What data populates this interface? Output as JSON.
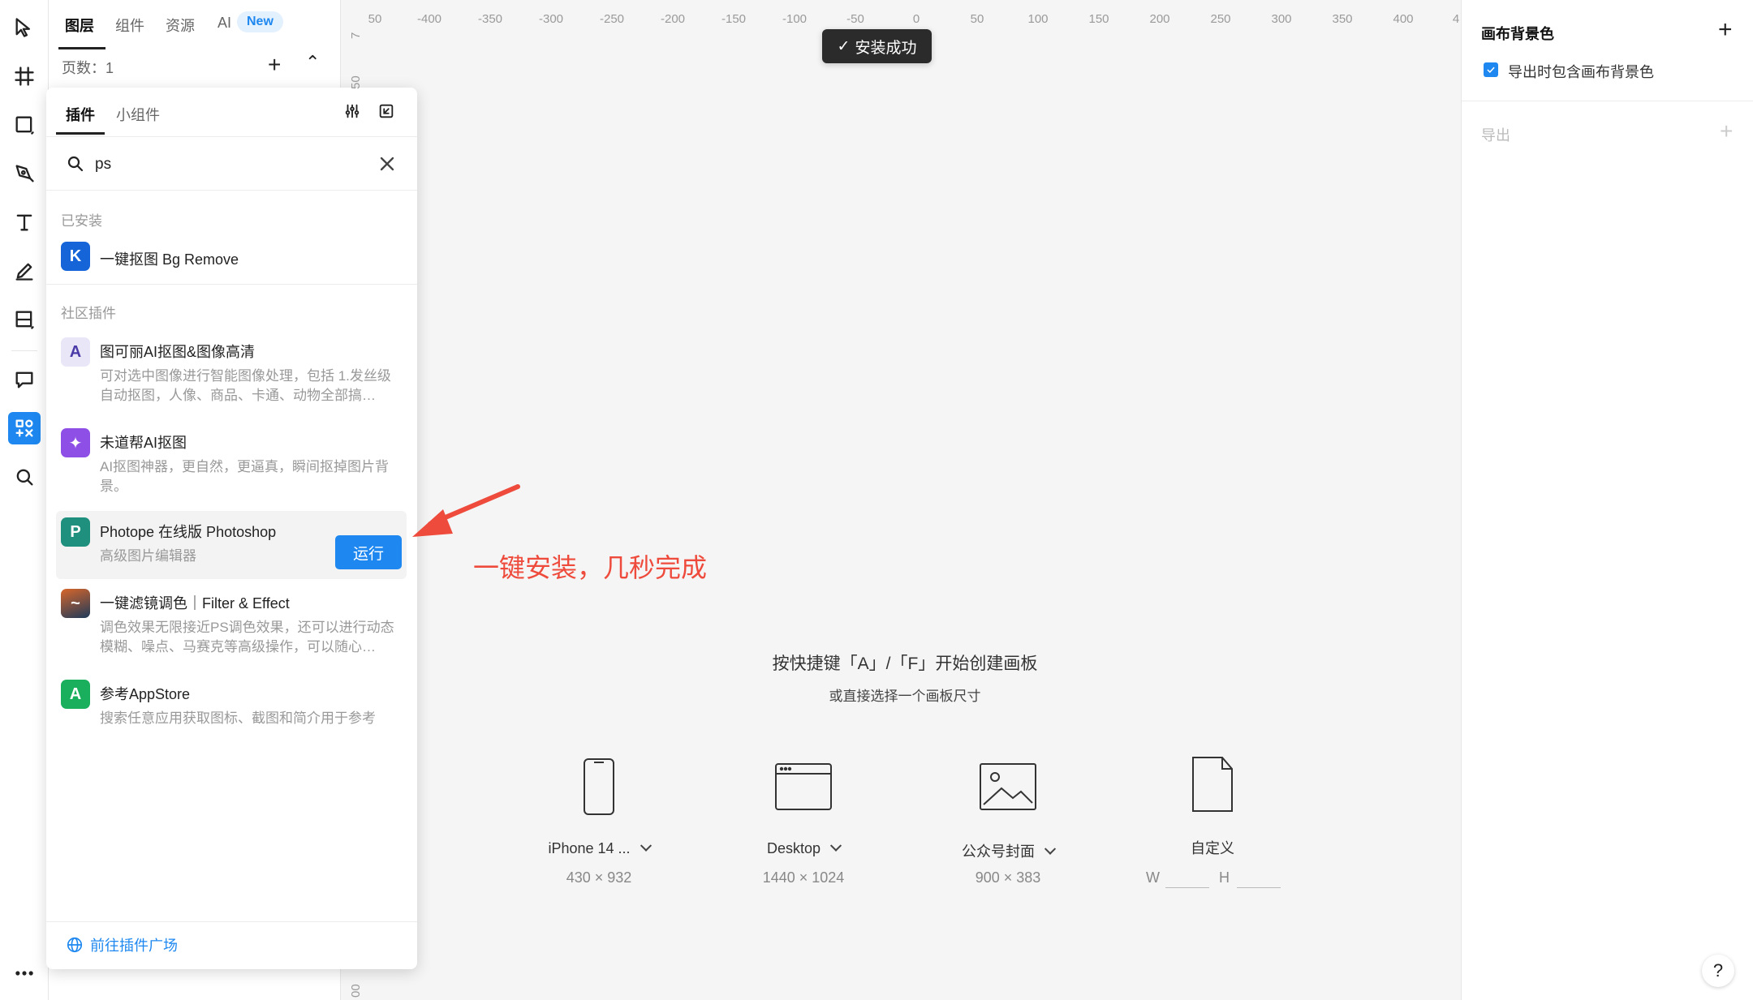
{
  "layer_panel": {
    "tabs": [
      {
        "label": "图层",
        "active": true
      },
      {
        "label": "组件",
        "active": false
      },
      {
        "label": "资源",
        "active": false
      },
      {
        "label": "AI",
        "active": false
      }
    ],
    "new_badge": "New",
    "pages_label": "页数：1"
  },
  "plugin_panel": {
    "tabs": [
      {
        "label": "插件",
        "active": true
      },
      {
        "label": "小组件",
        "active": false
      }
    ],
    "search": {
      "value": "ps",
      "placeholder": ""
    },
    "installed_label": "已安装",
    "installed": [
      {
        "title": "一键抠图 Bg Remove",
        "icon_color": "#1565d8"
      }
    ],
    "community_label": "社区插件",
    "community": [
      {
        "title": "图可丽AI抠图&图像高清",
        "desc": "可对选中图像进行智能图像处理，包括 1.发丝级自动抠图，人像、商品、卡通、动物全部搞…",
        "icon_color": "#e9e6f7"
      },
      {
        "title": "未道帮AI抠图",
        "desc": "AI抠图神器，更自然，更逼真，瞬间抠掉图片背景。",
        "icon_color": "#8e4fe6"
      },
      {
        "title": "Photope 在线版 Photoshop",
        "desc": "高级图片编辑器",
        "icon_color": "#1f8f7e",
        "run_label": "运行"
      },
      {
        "title": "一键滤镜调色｜Filter & Effect",
        "desc": "调色效果无限接近PS调色效果，还可以进行动态模糊、噪点、马赛克等高级操作，可以随心…",
        "icon_color": "#c0552b"
      },
      {
        "title": "参考AppStore",
        "desc": "搜索任意应用获取图标、截图和简介用于参考",
        "icon_color": "#1aaf5d"
      }
    ],
    "footer_link": "前往插件广场"
  },
  "canvas": {
    "ruler_top": [
      "50",
      "-400",
      "-350",
      "-300",
      "-250",
      "-200",
      "-150",
      "-100",
      "-50",
      "0",
      "50",
      "100",
      "150",
      "200",
      "250",
      "300",
      "350",
      "400",
      "4"
    ],
    "ruler_left": [
      "7",
      "50",
      "00"
    ],
    "toast": "安装成功",
    "annotation": "一键安装，几秒完成",
    "hint": "按快捷键「A」/「F」开始创建画板",
    "sub_hint": "或直接选择一个画板尺寸",
    "presets": [
      {
        "name": "iPhone 14 ...",
        "size": "430 × 932",
        "icon": "phone-icon"
      },
      {
        "name": "Desktop",
        "size": "1440 × 1024",
        "icon": "browser-window-icon"
      },
      {
        "name": "公众号封面",
        "size": "900 × 383",
        "icon": "image-icon"
      },
      {
        "name": "自定义",
        "icon": "file-icon",
        "w_label": "W",
        "h_label": "H"
      }
    ]
  },
  "right_panel": {
    "canvas_bg_title": "画布背景色",
    "include_bg_label": "导出时包含画布背景色",
    "export_label": "导出"
  },
  "colors": {
    "accent": "#1e88f0",
    "annotation": "#ee4b3c"
  }
}
